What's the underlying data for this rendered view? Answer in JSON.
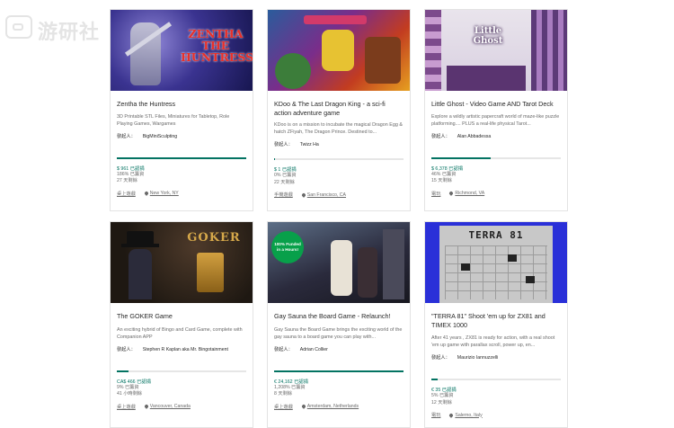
{
  "watermark": {
    "text": "游研社"
  },
  "labels": {
    "creator": "發起人："
  },
  "projects": [
    {
      "title": "Zentha the Huntress",
      "blurb": "3D Printable STL Files, Miniatures for Tabletop, Role Playing Games, Wargames",
      "creator": "BigMiniSculpting",
      "pledged": "$ 961 已認捐",
      "percent_funded": "186% 已籌資",
      "days": "27 天剩餘",
      "category": "桌上遊戲",
      "location": "New York, NY",
      "progress": 1.0,
      "thumb_text": "ZENTHA THE HUNTRESS"
    },
    {
      "title": "KDoo & The Last Dragon King - a sci-fi action adventure game",
      "blurb": "KDoo is on a mission to incubate the magical Dragon Egg & hatch ZFiyah, The Dragon Prince. Destined to...",
      "creator": "Twizz Ha",
      "pledged": "$ 1 已認捐",
      "percent_funded": "0% 已籌資",
      "days": "22 天剩餘",
      "category": "手機遊戲",
      "location": "San Francisco, CA",
      "progress": 0.01,
      "thumb_text": ""
    },
    {
      "title": "Little Ghost - Video Game AND Tarot Deck",
      "blurb": "Explore a wildly artistic papercraft world of maze-like puzzle platforming.... PLUS a real-life physical Tarot...",
      "creator": "Alan Abbadessa",
      "pledged": "$ 6,378 已認捐",
      "percent_funded": "46% 已籌資",
      "days": "15 天剩餘",
      "category": "電玩",
      "location": "Richmond, VA",
      "progress": 0.46,
      "thumb_text": "Little Ghost"
    },
    {
      "title": "The GOKER Game",
      "blurb": "An exciting hybrid of Bingo and Card Game, complete with Companion APP",
      "creator": "Stephen R Kaplan aka Mr. Bingotainment",
      "pledged": "CA$ 466 已認捐",
      "percent_funded": "9% 已籌資",
      "days": "41 小時剩餘",
      "category": "桌上遊戲",
      "location": "Vancouver, Canada",
      "progress": 0.09,
      "thumb_text": "GOKER"
    },
    {
      "title": "Gay Sauna the Board Game - Relaunch!",
      "blurb": "Gay Sauna the Board Game brings the exciting world of the gay sauna to a board game you can play with...",
      "creator": "Adrian Collier",
      "pledged": "€ 24,162 已認捐",
      "percent_funded": "1,208% 已籌資",
      "days": "8 天剩餘",
      "category": "桌上遊戲",
      "location": "Amsterdam, Netherlands",
      "progress": 1.0,
      "thumb_text": "100% Funded in a Hours!"
    },
    {
      "title": "\"TERRA 81\" Shoot 'em up for ZX81 and TIMEX 1000",
      "blurb": "After 41 years , ZX81 is ready for action, with a real shoot 'em up game with parallax scroll, power up, en...",
      "creator": "Maurizio Iannuzzelli",
      "pledged": "€ 35 已認捐",
      "percent_funded": "5% 已籌資",
      "days": "12 天剩餘",
      "category": "電玩",
      "location": "Salerno, Italy",
      "progress": 0.05,
      "thumb_text": "TERRA 81"
    }
  ]
}
